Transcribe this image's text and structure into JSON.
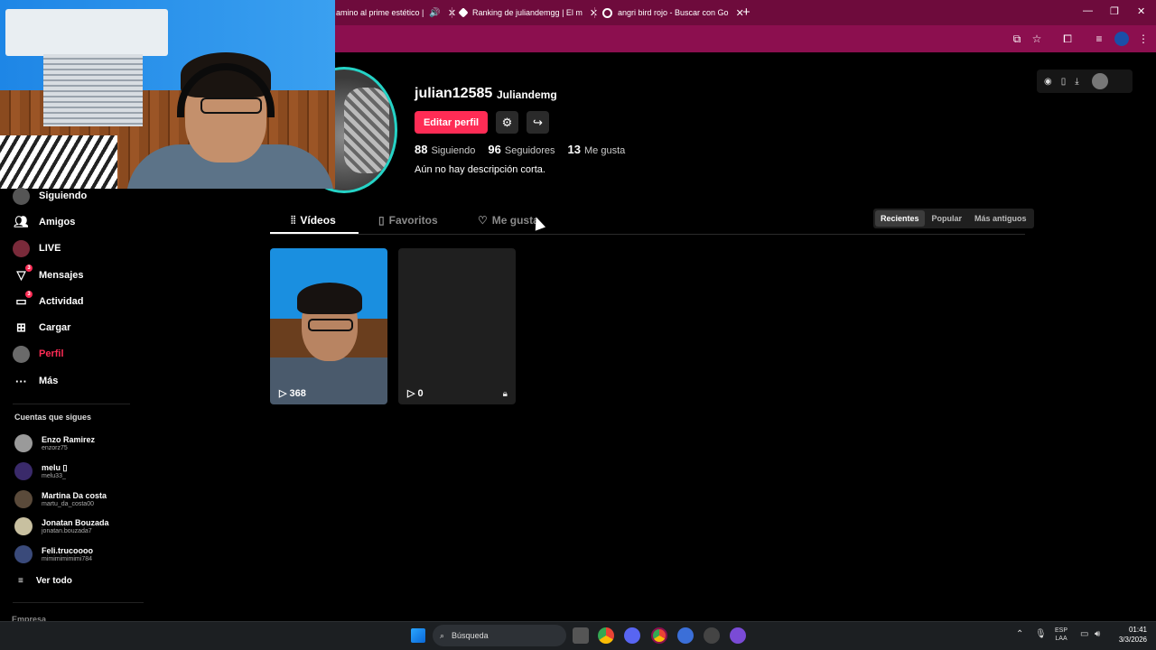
{
  "browser": {
    "tabs": [
      {
        "label": "amino al prime estético |",
        "icon": "speaker-icon"
      },
      {
        "label": "Ranking de juliandemgg | El m",
        "icon": "diamond-icon"
      },
      {
        "label": "angri bird rojo - Buscar con Go",
        "icon": "google-icon"
      }
    ],
    "new_tab": "+",
    "accent": "#8c0f4f"
  },
  "profile": {
    "username": "julian12585",
    "nickname": "Juliandemg",
    "edit_label": "Editar perfil",
    "stats": [
      {
        "value": "88",
        "label": "Siguiendo"
      },
      {
        "value": "96",
        "label": "Seguidores"
      },
      {
        "value": "13",
        "label": "Me gusta"
      }
    ],
    "bio": "Aún no hay descripción corta."
  },
  "tabs": [
    {
      "label": "Vídeos",
      "icon": "grid-icon",
      "active": true
    },
    {
      "label": "Favoritos",
      "icon": "bookmark-icon",
      "active": false
    },
    {
      "label": "Me gusta",
      "icon": "heart-icon",
      "active": false
    }
  ],
  "sort": [
    "Recientes",
    "Popular",
    "Más antiguos"
  ],
  "videos": [
    {
      "views": "368"
    },
    {
      "views": "0"
    }
  ],
  "sidebar": {
    "items": [
      {
        "label": "Siguiendo",
        "icon": "following-icon"
      },
      {
        "label": "Amigos",
        "icon": "friends-icon"
      },
      {
        "label": "LIVE",
        "icon": "live-icon"
      },
      {
        "label": "Mensajes",
        "icon": "message-icon",
        "badge": "3"
      },
      {
        "label": "Actividad",
        "icon": "activity-icon",
        "badge": "3"
      },
      {
        "label": "Cargar",
        "icon": "upload-icon"
      },
      {
        "label": "Perfil",
        "icon": "profile-icon"
      },
      {
        "label": "Más",
        "icon": "more-icon"
      }
    ],
    "following_heading": "Cuentas que sigues",
    "following": [
      {
        "name": "Enzo Ramirez",
        "handle": "enzorz75"
      },
      {
        "name": "melu ▯",
        "handle": "melu33_"
      },
      {
        "name": "Martina Da costa",
        "handle": "martu_da_costa00"
      },
      {
        "name": "Jonatan Bouzada",
        "handle": "jonatan.bouzada7"
      },
      {
        "name": "Feli.trucoooo",
        "handle": "mimimimimimi784"
      }
    ],
    "see_all": "Ver todo",
    "company": "Empresa"
  },
  "taskbar": {
    "search": "Búsqueda",
    "lang": "ESP",
    "region": "LAA",
    "time": "01:41",
    "date": "3/3/2026"
  }
}
